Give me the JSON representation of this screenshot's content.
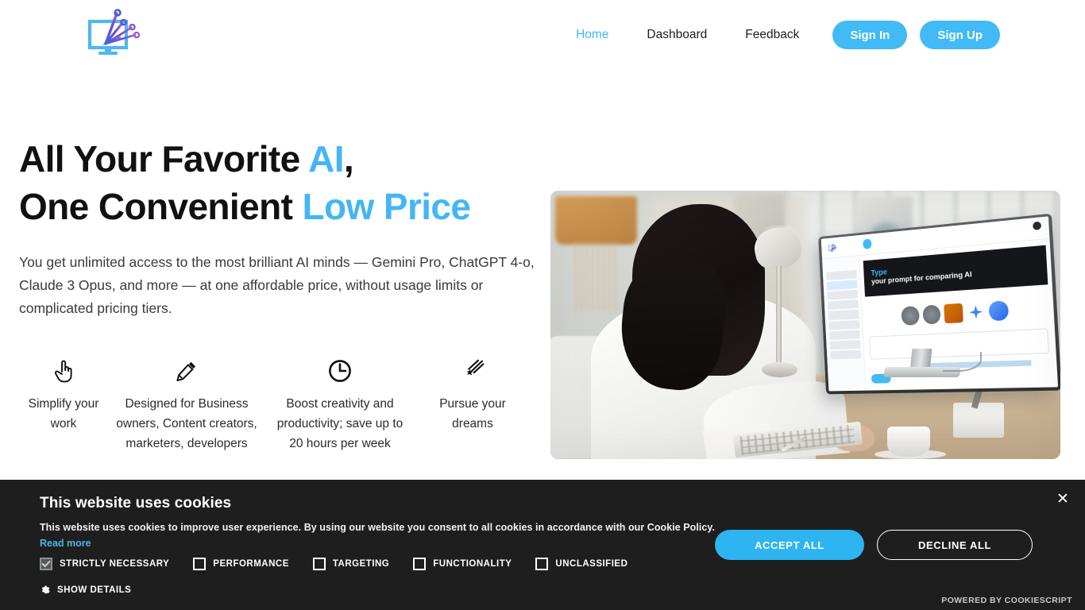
{
  "header": {
    "logo_alt": "monitor-network-logo",
    "nav": [
      {
        "label": "Home",
        "active": true
      },
      {
        "label": "Dashboard",
        "active": false
      },
      {
        "label": "Feedback",
        "active": false
      }
    ],
    "sign_in_label": "Sign In",
    "sign_up_label": "Sign Up"
  },
  "hero": {
    "title_line1_plain": "All Your Favorite ",
    "title_line1_accent": "AI",
    "title_line1_tail": ",",
    "title_line2_plain": "One Convenient ",
    "title_line2_accent": "Low Price",
    "subtitle": "You get unlimited access to the most brilliant AI minds — Gemini Pro, ChatGPT 4-o, Claude 3 Opus, and more — at one affordable price, without usage limits or complicated pricing tiers.",
    "features": [
      {
        "icon": "pointing-hand-icon",
        "text": "Simplify your work"
      },
      {
        "icon": "pencil-icon",
        "text": "Designed for Business owners, Content creators, marketers, developers"
      },
      {
        "icon": "clock-icon",
        "text": "Boost creativity and productivity; save up to 20 hours per week"
      },
      {
        "icon": "shooting-star-icon",
        "text": "Pursue your dreams"
      }
    ],
    "image": {
      "alt": "woman-at-desk-using-ai-comparison-app",
      "screen_banner_line1": "Type",
      "screen_banner_line2": "your prompt for comparing AI"
    }
  },
  "cookie": {
    "title": "This website uses cookies",
    "description": "This website uses cookies to improve user experience. By using our website you consent to all cookies in accordance with our Cookie Policy.",
    "read_more": "Read more",
    "categories": [
      {
        "label": "STRICTLY NECESSARY",
        "checked": true
      },
      {
        "label": "PERFORMANCE",
        "checked": false
      },
      {
        "label": "TARGETING",
        "checked": false
      },
      {
        "label": "FUNCTIONALITY",
        "checked": false
      },
      {
        "label": "UNCLASSIFIED",
        "checked": false
      }
    ],
    "show_details": "SHOW DETAILS",
    "accept_label": "ACCEPT ALL",
    "decline_label": "DECLINE ALL",
    "powered_by": "POWERED BY COOKIESCRIPT",
    "close_icon": "✕"
  },
  "colors": {
    "accent_blue": "#45b6f5",
    "button_blue": "#41baf5",
    "cookie_bg": "#1e1e1e",
    "cookie_link": "#4ab6e8",
    "accept_blue": "#2eb4f0",
    "text_dark": "#111111"
  }
}
